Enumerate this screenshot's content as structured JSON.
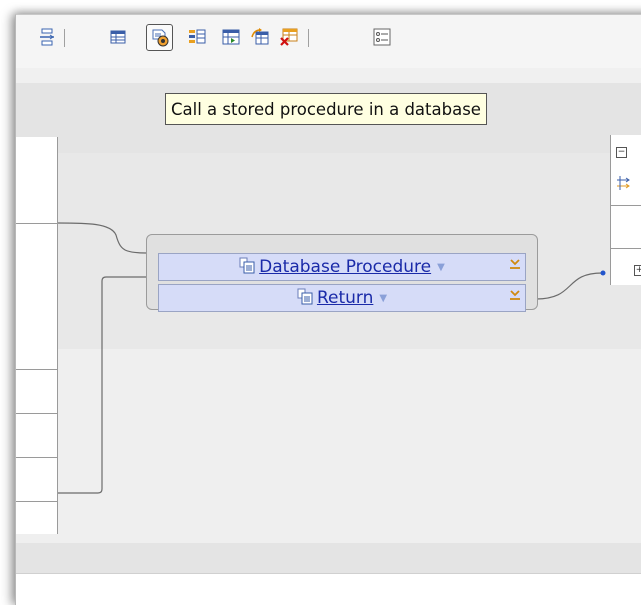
{
  "tooltip": {
    "text": "Call a stored procedure in a database"
  },
  "toolbar": {
    "buttons": [
      {
        "icon": "swap-arrows-icon"
      },
      {
        "icon": "table-icon"
      },
      {
        "icon": "stored-procedure-icon",
        "active": true
      },
      {
        "icon": "column-mapping-icon"
      },
      {
        "icon": "table-select-icon"
      },
      {
        "icon": "table-update-icon"
      },
      {
        "icon": "table-delete-icon"
      },
      {
        "icon": "list-view-icon"
      }
    ]
  },
  "function_box": {
    "procedure_label": "Database Procedure",
    "return_label": "Return"
  },
  "colors": {
    "field_fill": "#d6dcf8",
    "link": "#1a2aa8",
    "connector": "#6b6b6b",
    "connector_endpoint": "#2255cc"
  }
}
